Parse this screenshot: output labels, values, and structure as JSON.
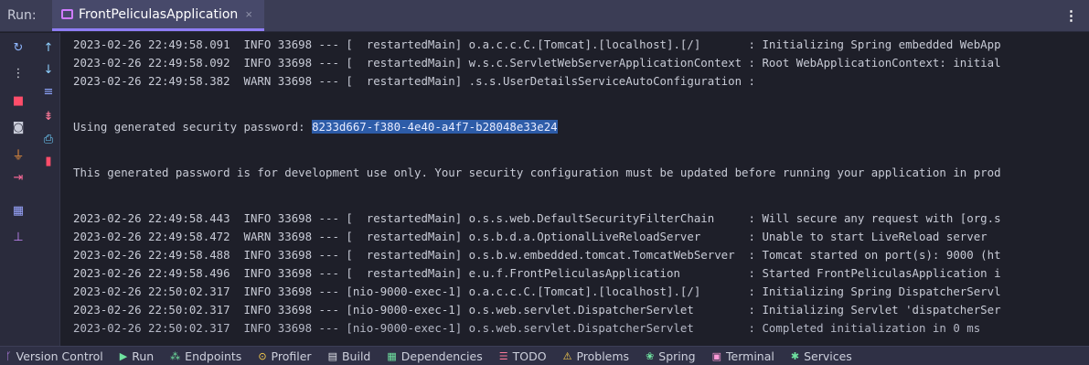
{
  "header": {
    "run_label": "Run:",
    "tab_title": "FrontPeliculasApplication",
    "tab_close": "×",
    "menu_icon": "⋮"
  },
  "console": {
    "lines": [
      "2023-02-26 22:49:58.091  INFO 33698 --- [  restartedMain] o.a.c.c.C.[Tomcat].[localhost].[/]       : Initializing Spring embedded WebApp",
      "2023-02-26 22:49:58.092  INFO 33698 --- [  restartedMain] w.s.c.ServletWebServerApplicationContext : Root WebApplicationContext: initial",
      "2023-02-26 22:49:58.382  WARN 33698 --- [  restartedMain] .s.s.UserDetailsServiceAutoConfiguration :",
      "",
      "Using generated security password: ",
      "",
      "This generated password is for development use only. Your security configuration must be updated before running your application in prod",
      "",
      "2023-02-26 22:49:58.443  INFO 33698 --- [  restartedMain] o.s.s.web.DefaultSecurityFilterChain     : Will secure any request with [org.s",
      "2023-02-26 22:49:58.472  WARN 33698 --- [  restartedMain] o.s.b.d.a.OptionalLiveReloadServer       : Unable to start LiveReload server",
      "2023-02-26 22:49:58.488  INFO 33698 --- [  restartedMain] o.s.b.w.embedded.tomcat.TomcatWebServer  : Tomcat started on port(s): 9000 (ht",
      "2023-02-26 22:49:58.496  INFO 33698 --- [  restartedMain] e.u.f.FrontPeliculasApplication          : Started FrontPeliculasApplication i",
      "2023-02-26 22:50:02.317  INFO 33698 --- [nio-9000-exec-1] o.a.c.c.C.[Tomcat].[localhost].[/]       : Initializing Spring DispatcherServl",
      "2023-02-26 22:50:02.317  INFO 33698 --- [nio-9000-exec-1] o.s.web.servlet.DispatcherServlet        : Initializing Servlet 'dispatcherSer",
      "2023-02-26 22:50:02.317  INFO 33698 --- [nio-9000-exec-1] o.s.web.servlet.DispatcherServlet        : Completed initialization in 0 ms"
    ],
    "password": "8233d667-f380-4e40-a4f7-b28048e33e24"
  },
  "toolbar_left": [
    {
      "name": "rerun-icon",
      "glyph": "↻",
      "color": "#8fb7ff"
    },
    {
      "name": "more-icon",
      "glyph": "⋮",
      "color": "#dfe1e8"
    },
    {
      "name": "stop-icon",
      "glyph": "■",
      "color": "#ff4d6a"
    },
    {
      "name": "camera-icon",
      "glyph": "◙",
      "color": "#c9ccd9"
    },
    {
      "name": "plug-icon",
      "glyph": "⏚",
      "color": "#ff9a3c"
    },
    {
      "name": "exit-icon",
      "glyph": "⇥",
      "color": "#ff6b9a"
    },
    {
      "name": "layout-icon",
      "glyph": "▦",
      "color": "#9aa6ff"
    },
    {
      "name": "pin-icon",
      "glyph": "⊥",
      "color": "#c98bff"
    }
  ],
  "toolbar_right": [
    {
      "name": "scroll-up-icon",
      "glyph": "↑",
      "color": "#8fd0ff"
    },
    {
      "name": "scroll-down-icon",
      "glyph": "↓",
      "color": "#8fd0ff"
    },
    {
      "name": "soft-wrap-icon",
      "glyph": "≡",
      "color": "#8fa6ff"
    },
    {
      "name": "scroll-to-end-icon",
      "glyph": "⇟",
      "color": "#ff7a9a"
    },
    {
      "name": "print-icon",
      "glyph": "⎙",
      "color": "#6fd0ff"
    },
    {
      "name": "delete-icon",
      "glyph": "▮",
      "color": "#ff4d6a"
    }
  ],
  "statusbar": [
    {
      "name": "version-control",
      "icon": "ᚴ",
      "color": "#c98bff",
      "label": "Version Control"
    },
    {
      "name": "run",
      "icon": "▶",
      "color": "#6fe3a0",
      "label": "Run"
    },
    {
      "name": "endpoints",
      "icon": "⁂",
      "color": "#6fe3a0",
      "label": "Endpoints"
    },
    {
      "name": "profiler",
      "icon": "⊙",
      "color": "#ffd24d",
      "label": "Profiler"
    },
    {
      "name": "build",
      "icon": "▤",
      "color": "#dfe1e8",
      "label": "Build"
    },
    {
      "name": "dependencies",
      "icon": "▦",
      "color": "#6fe3a0",
      "label": "Dependencies"
    },
    {
      "name": "todo",
      "icon": "☰",
      "color": "#ff7a9a",
      "label": "TODO"
    },
    {
      "name": "problems",
      "icon": "⚠",
      "color": "#ffd24d",
      "label": "Problems"
    },
    {
      "name": "spring",
      "icon": "❀",
      "color": "#6fe3a0",
      "label": "Spring"
    },
    {
      "name": "terminal",
      "icon": "▣",
      "color": "#ff9ad8",
      "label": "Terminal"
    },
    {
      "name": "services",
      "icon": "✱",
      "color": "#6fe3a0",
      "label": "Services"
    }
  ]
}
